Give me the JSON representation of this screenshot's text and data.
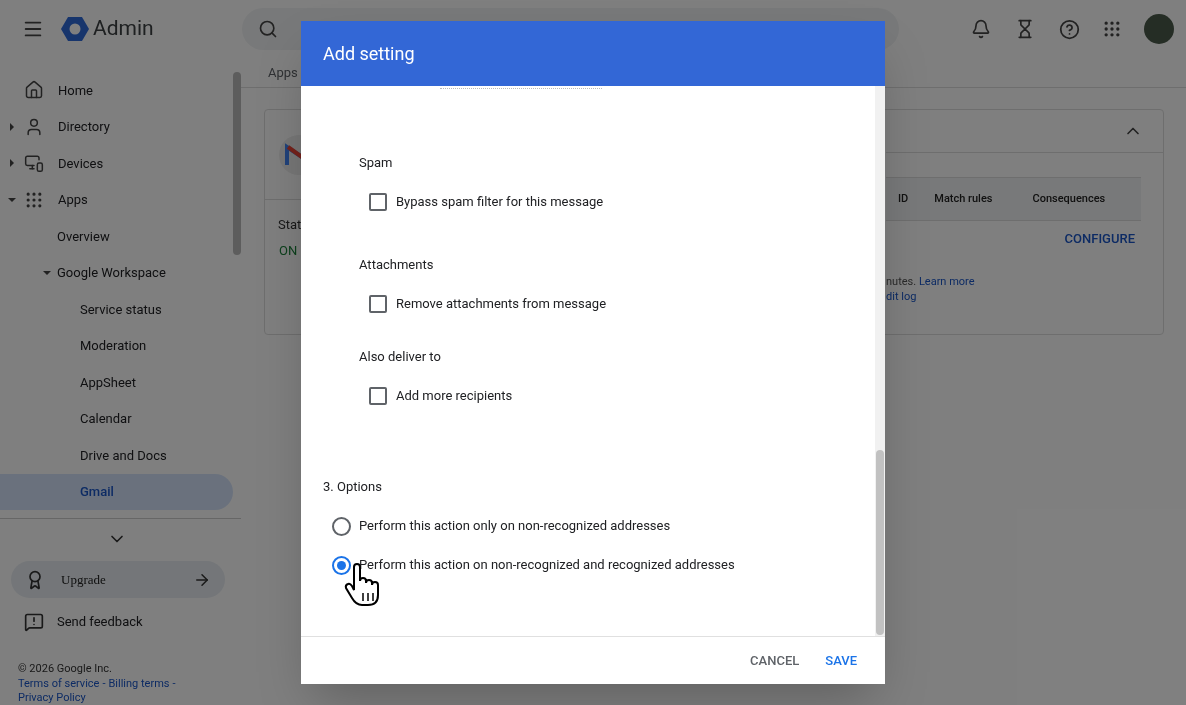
{
  "app": {
    "name": "Admin"
  },
  "sidebar": {
    "items": [
      {
        "label": "Home",
        "selected": false
      },
      {
        "label": "Directory",
        "selected": false,
        "expanded": false
      },
      {
        "label": "Devices",
        "selected": false,
        "expanded": false
      },
      {
        "label": "Apps",
        "selected": false,
        "expanded": true,
        "children": [
          {
            "label": "Overview",
            "selected": false
          },
          {
            "label": "Google Workspace",
            "selected": false,
            "expanded": true,
            "children": [
              {
                "label": "Service status",
                "selected": false
              },
              {
                "label": "Moderation",
                "selected": false
              },
              {
                "label": "AppSheet",
                "selected": false
              },
              {
                "label": "Calendar",
                "selected": false
              },
              {
                "label": "Drive and Docs",
                "selected": false
              },
              {
                "label": "Gmail",
                "selected": true
              }
            ]
          }
        ]
      }
    ],
    "upgrade": "Upgrade",
    "feedback": "Send feedback",
    "footer": {
      "copyright": "© 2026 Google Inc.",
      "separator": "-",
      "links": [
        "Terms of service",
        "Billing terms",
        "Privacy Policy"
      ]
    }
  },
  "main": {
    "breadcrumb": "Apps",
    "card": {
      "status_label": "Stat",
      "status_value": "ON",
      "table_columns": [
        "ID",
        "Match rules",
        "Consequences"
      ],
      "configure": "CONFIGURE",
      "note": "nutes.",
      "learn_more": "Learn more",
      "audit_link": "dit log"
    }
  },
  "dialog": {
    "title": "Add setting",
    "sections": [
      {
        "label": "Spam",
        "options": [
          {
            "label": "Bypass spam filter for this message",
            "checked": false
          }
        ]
      },
      {
        "label": "Attachments",
        "options": [
          {
            "label": "Remove attachments from message",
            "checked": false
          }
        ]
      },
      {
        "label": "Also deliver to",
        "options": [
          {
            "label": "Add more recipients",
            "checked": false
          }
        ]
      }
    ],
    "options": {
      "heading": "3. Options",
      "choices": [
        {
          "label": "Perform this action only on non-recognized addresses",
          "selected": false
        },
        {
          "label": "Perform this action on non-recognized and recognized addresses",
          "selected": true
        }
      ]
    },
    "buttons": [
      "CANCEL",
      "SAVE"
    ]
  }
}
